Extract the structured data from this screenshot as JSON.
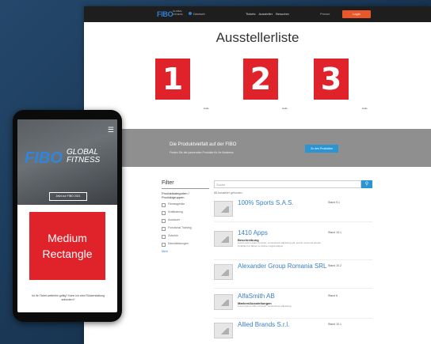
{
  "desktop": {
    "nav": {
      "logo": "FIBO",
      "logo_sub": "GLOBAL FITNESS",
      "lang": "Deutsch",
      "menu": [
        "Tickets",
        "Aussteller",
        "Besucher"
      ],
      "extra": "Presse",
      "cta": "Login"
    },
    "title": "Ausstellerliste",
    "numbers": [
      {
        "label": "1",
        "caption": "Halle"
      },
      {
        "label": "2",
        "caption": "Halle"
      },
      {
        "label": "3",
        "caption": "Halle"
      }
    ],
    "banner": {
      "title": "Die Produktvielfalt auf der FIBO",
      "subtitle": "Finden Sie die passenden Produkte für Ihr Business",
      "button": "Zu den Produkten"
    },
    "filter": {
      "title": "Filter",
      "heading": "Produktkategorien / Produktgruppen",
      "items": [
        "Fitnessgeräte",
        "Krafttraining",
        "Ausdauer",
        "Functional Training",
        "Zubehör",
        "Dienstleistungen"
      ],
      "more": "Mehr"
    },
    "search": {
      "placeholder": "Suche",
      "button_icon": "search-icon",
      "results": "88 Aussteller gefunden"
    },
    "exhibitors": [
      {
        "name": "100% Sports S.A.S.",
        "stand": "Stand 9.1",
        "desc_heading": "",
        "desc": ""
      },
      {
        "name": "1410 Apps",
        "stand": "Stand 10.1",
        "desc_heading": "Beschreibung",
        "desc": "Lorem ipsum dolor sit amet, consectetur adipiscing elit, sed do eiusmod tempor incididunt ut labore et dolore magna aliqua."
      },
      {
        "name": "Alexander Group Romania SRL",
        "stand": "Stand 10.2",
        "desc_heading": "",
        "desc": ""
      },
      {
        "name": "AlfaSmith AB",
        "stand": "Stand 6",
        "desc_heading": "Marken/Ausstellungen",
        "desc": "Lorem ipsum dolor sit amet, consectetur adipiscing"
      },
      {
        "name": "Allied Brands S.r.l.",
        "stand": "Stand 10.1",
        "desc_heading": "",
        "desc": ""
      }
    ]
  },
  "phone": {
    "logo": "FIBO",
    "logo_global": "GLOBAL",
    "logo_fitness": "FITNESS",
    "hero_button": "Jetzt zur FIBO 2021",
    "ad_line1": "Medium",
    "ad_line2": "Rectangle",
    "footer_text": "Ist Ihr Ticket weiterhin gültig? Kann ich eine Rückerstattung anfordern?"
  },
  "colors": {
    "accent_red": "#e0232b",
    "accent_blue": "#2b95d4",
    "cta_orange": "#e8572a",
    "background": "#1f3d5c"
  }
}
